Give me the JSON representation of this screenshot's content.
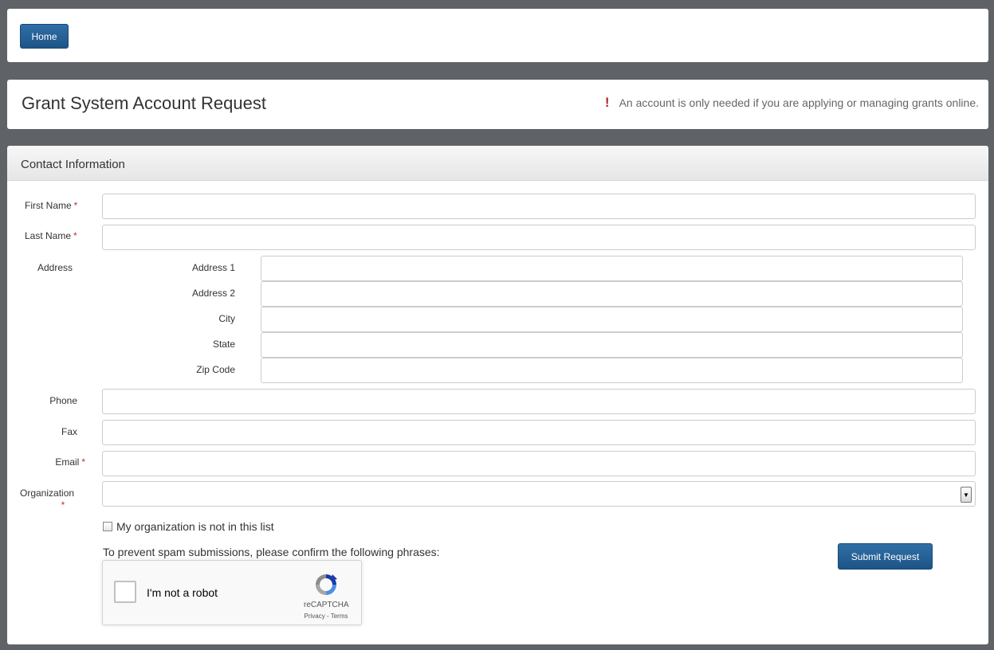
{
  "nav": {
    "home_label": "Home"
  },
  "header": {
    "title": "Grant System Account Request",
    "notice_icon": "!",
    "notice": "An account is only needed if you are applying or managing grants online."
  },
  "form": {
    "section_title": "Contact Information",
    "required_marker": "*",
    "first_name_label": "First Name",
    "last_name_label": "Last Name",
    "address_label": "Address",
    "address1_label": "Address 1",
    "address2_label": "Address 2",
    "city_label": "City",
    "state_label": "State",
    "zip_label": "Zip Code",
    "phone_label": "Phone",
    "fax_label": "Fax",
    "email_label": "Email",
    "organization_label": "Organization",
    "org_not_listed_label": "My organization is not in this list",
    "spam_prompt": "To prevent spam submissions, please confirm the following phrases:",
    "submit_label": "Submit Request"
  },
  "recaptcha": {
    "label": "I'm not a robot",
    "brand": "reCAPTCHA",
    "links": "Privacy - Terms"
  },
  "colors": {
    "page_background": "#5f6266",
    "button_primary": "#245f96",
    "required": "#c9302c"
  }
}
